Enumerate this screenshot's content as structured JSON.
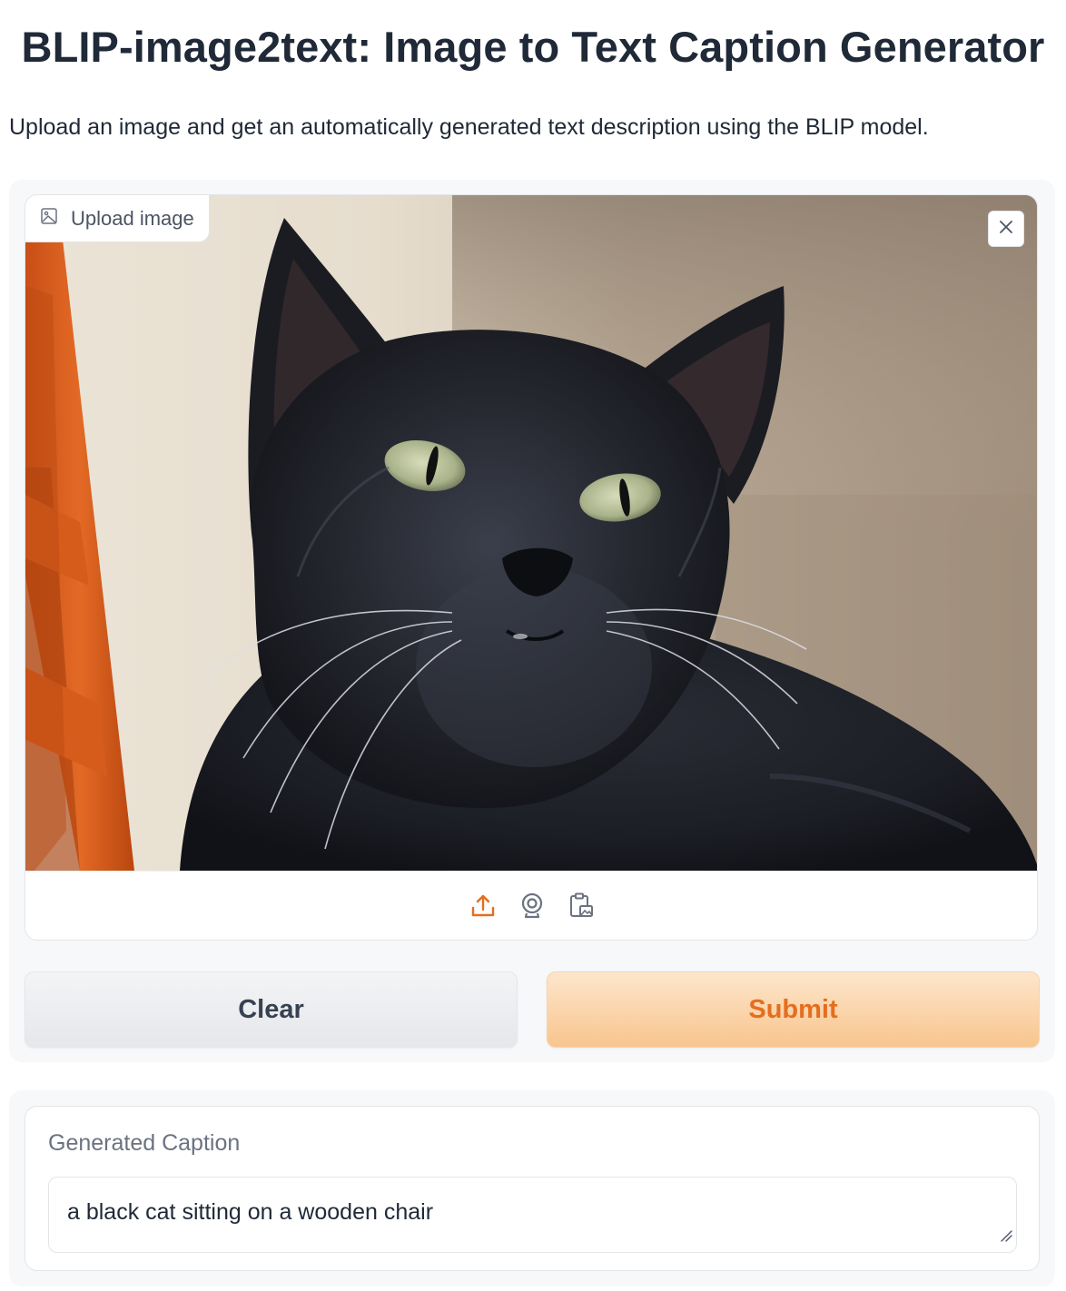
{
  "app": {
    "title": "BLIP-image2text: Image to Text Caption Generator",
    "description": "Upload an image and get an automatically generated text description using the BLIP model."
  },
  "image_input": {
    "label": "Upload image",
    "label_icon": "image-icon",
    "close_icon": "close-icon",
    "photo_subject": "black cat sitting on a wooden chair",
    "sources": [
      {
        "icon": "upload-icon",
        "active": true
      },
      {
        "icon": "webcam-icon",
        "active": false
      },
      {
        "icon": "clipboard-icon",
        "active": false
      }
    ]
  },
  "buttons": {
    "clear_label": "Clear",
    "submit_label": "Submit"
  },
  "output": {
    "label": "Generated Caption",
    "value": "a black cat sitting on a wooden chair"
  },
  "colors": {
    "accent": "#e46e1f",
    "submit_bg": "#f8c58e",
    "clear_bg": "#e5e7eb"
  }
}
